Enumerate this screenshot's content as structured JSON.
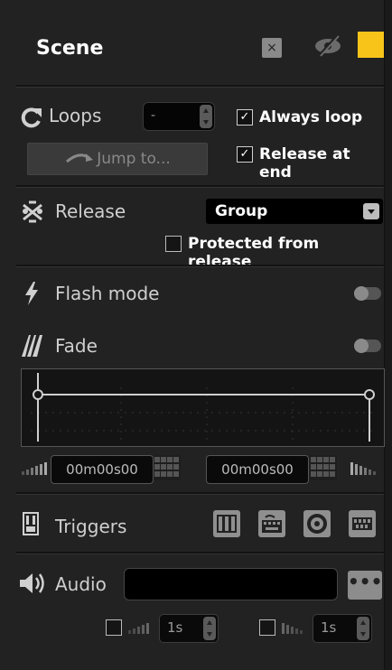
{
  "header": {
    "title": "Scene",
    "close_glyph": "×",
    "visibility_icon": "eye-slash-icon",
    "color": "#f8c41a"
  },
  "loops": {
    "label": "Loops",
    "value": "-",
    "jump_button": "Jump to...",
    "always_loop": {
      "label": "Always loop",
      "checked": true
    },
    "release_at_end": {
      "label": "Release at end",
      "checked": true
    }
  },
  "release": {
    "label": "Release",
    "select_value": "Group",
    "protected": {
      "label": "Protected from release",
      "checked": false
    }
  },
  "flash": {
    "label": "Flash mode",
    "enabled": false
  },
  "fade": {
    "label": "Fade",
    "enabled": false,
    "fade_in": "00m00s00",
    "fade_out": "00m00s00"
  },
  "triggers": {
    "label": "Triggers",
    "icons": [
      "midi-piano-icon",
      "keyboard-icon",
      "timecode-disc-icon",
      "dmx-input-icon"
    ]
  },
  "audio": {
    "label": "Audio",
    "file": "",
    "more_glyph": "•••",
    "fade_in": {
      "checked": false,
      "value": "1s"
    },
    "fade_out": {
      "checked": false,
      "value": "1s"
    }
  },
  "check_glyph": "✓",
  "colors": {
    "accent": "#f8c41a",
    "panel": "#222222"
  }
}
